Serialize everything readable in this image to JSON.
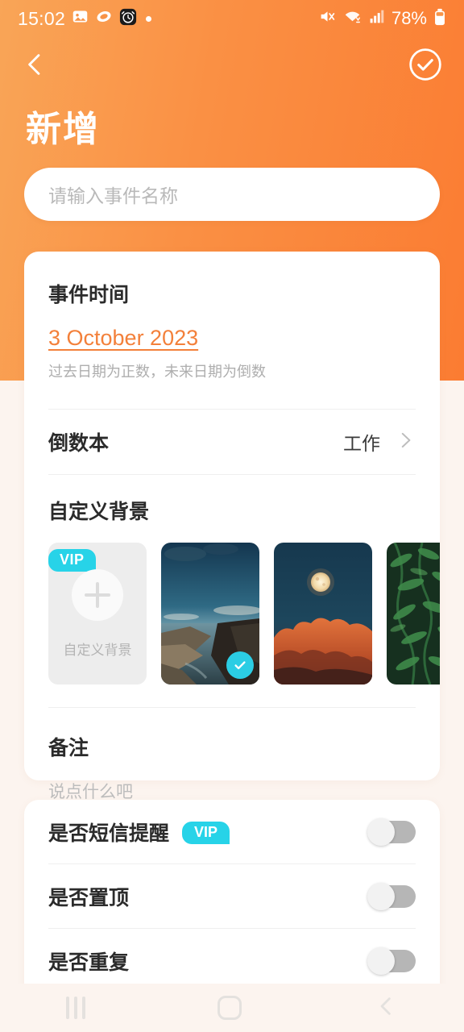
{
  "status_bar": {
    "time": "15:02",
    "battery_percent": "78%",
    "left_icons": [
      "image-icon",
      "shell-icon",
      "alarm-clock-icon",
      "dot-icon"
    ],
    "right_icons": [
      "mute-icon",
      "wifi-icon",
      "signal-icon",
      "battery-icon"
    ]
  },
  "header": {
    "title": "新增",
    "back_icon": "chevron-left-icon",
    "confirm_icon": "check-circle-icon",
    "gradient_from": "#F9A557",
    "gradient_to": "#FB7C32"
  },
  "event_name": {
    "value": "",
    "placeholder": "请输入事件名称"
  },
  "event_time": {
    "title": "事件时间",
    "date": "3 October 2023",
    "hint": "过去日期为正数，未来日期为倒数",
    "date_color": "#F3803A"
  },
  "countdown_book": {
    "label": "倒数本",
    "value": "工作",
    "chevron_icon": "chevron-right-icon"
  },
  "background": {
    "title": "自定义背景",
    "vip_label": "VIP",
    "vip_color": "#27D3E8",
    "custom_tile_caption": "自定义背景",
    "plus_icon": "plus-icon",
    "selected_index": 1,
    "tiles": [
      {
        "name": "custom-upload",
        "type": "custom"
      },
      {
        "name": "coastal-cliff-photo",
        "type": "image",
        "selected": true
      },
      {
        "name": "moon-clouds-photo",
        "type": "image",
        "selected": false
      },
      {
        "name": "green-foliage-photo",
        "type": "image",
        "selected": false
      }
    ]
  },
  "notes": {
    "title": "备注",
    "value": "",
    "placeholder": "说点什么吧"
  },
  "toggles": [
    {
      "label": "是否短信提醒",
      "vip": "VIP",
      "on": false
    },
    {
      "label": "是否置顶",
      "vip": null,
      "on": false
    },
    {
      "label": "是否重复",
      "vip": null,
      "on": false
    }
  ],
  "android_nav": {
    "recents_icon": "recents-icon",
    "home_icon": "home-icon",
    "back_icon": "back-icon"
  }
}
